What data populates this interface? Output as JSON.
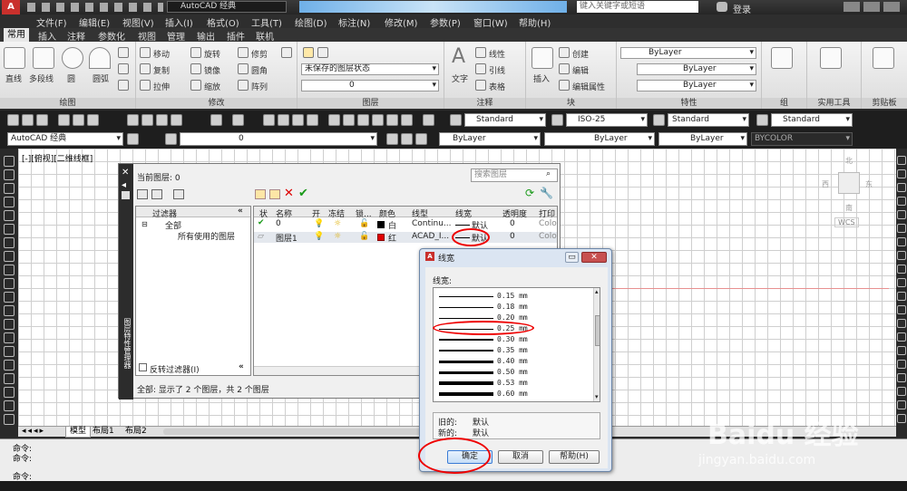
{
  "titlebar": {
    "app_combo": "AutoCAD 经典",
    "search_placeholder": "键入关键字或短语",
    "login": "登录"
  },
  "menu": [
    "文件(F)",
    "编辑(E)",
    "视图(V)",
    "插入(I)",
    "格式(O)",
    "工具(T)",
    "绘图(D)",
    "标注(N)",
    "修改(M)",
    "参数(P)",
    "窗口(W)",
    "帮助(H)"
  ],
  "ribbon_tabs": [
    "常用",
    "插入",
    "注释",
    "参数化",
    "视图",
    "管理",
    "输出",
    "插件",
    "联机"
  ],
  "ribbon": {
    "draw": {
      "label": "绘图",
      "items": [
        "直线",
        "多段线",
        "圆",
        "圆弧"
      ]
    },
    "modify": {
      "label": "修改",
      "items": [
        "移动",
        "旋转",
        "修剪",
        "复制",
        "镜像",
        "圆角",
        "拉伸",
        "缩放",
        "阵列"
      ]
    },
    "layers": {
      "label": "图层",
      "state_combo": "未保存的图层状态",
      "layer_combo": "0"
    },
    "annotation": {
      "label": "注释",
      "text": "文字",
      "items": [
        "线性",
        "引线",
        "表格"
      ]
    },
    "block": {
      "label": "块",
      "insert": "插入",
      "items": [
        "创建",
        "编辑",
        "编辑属性"
      ]
    },
    "properties": {
      "label": "特性",
      "combos": [
        "ByLayer",
        "ByLayer",
        "ByLayer"
      ]
    },
    "group": {
      "label": "组"
    },
    "utilities": {
      "label": "实用工具"
    },
    "clipboard": {
      "label": "剪贴板"
    }
  },
  "toolbar1": {
    "text_style": "Standard",
    "dim_style": "ISO-25",
    "table_style": "Standard",
    "mleader_style": "Standard"
  },
  "toolbar2": {
    "workspace": "AutoCAD 经典",
    "layer": "0",
    "color": "ByLayer",
    "linetype": "ByLayer",
    "lineweight": "ByLayer",
    "plotstyle": "BYCOLOR"
  },
  "viewport_label": "[-][俯视][二维线框]",
  "viewcube": {
    "north": "北",
    "south": "南",
    "west": "西",
    "east": "东",
    "wcs": "WCS"
  },
  "layer_manager": {
    "current_layer": "当前图层: 0",
    "search_placeholder": "搜索图层",
    "side_title": "图层特性管理器",
    "filters_header": "过滤器",
    "tree": [
      "全部",
      "所有使用的图层"
    ],
    "invert_filter": "反转过滤器(I)",
    "columns": [
      "状",
      "名称",
      "开",
      "冻结",
      "锁...",
      "颜色",
      "线型",
      "线宽",
      "透明度",
      "打印"
    ],
    "rows": [
      {
        "name": "0",
        "color": "白",
        "color_hex": "#000000",
        "linetype": "Continu...",
        "lineweight": "默认",
        "transparency": "0",
        "plot": "Colo"
      },
      {
        "name": "图层1",
        "color": "红",
        "color_hex": "#e00000",
        "linetype": "ACAD_I...",
        "lineweight": "默认",
        "transparency": "0",
        "plot": "Colo"
      }
    ],
    "status": "全部: 显示了 2 个图层，共 2 个图层"
  },
  "lineweight_dialog": {
    "title": "线宽",
    "list_label": "线宽:",
    "items": [
      {
        "value": "0.15 mm",
        "thickness": 1
      },
      {
        "value": "0.18 mm",
        "thickness": 1
      },
      {
        "value": "0.20 mm",
        "thickness": 1
      },
      {
        "value": "0.25 mm",
        "thickness": 1
      },
      {
        "value": "0.30 mm",
        "thickness": 2
      },
      {
        "value": "0.35 mm",
        "thickness": 2
      },
      {
        "value": "0.40 mm",
        "thickness": 3
      },
      {
        "value": "0.50 mm",
        "thickness": 3
      },
      {
        "value": "0.53 mm",
        "thickness": 4
      },
      {
        "value": "0.60 mm",
        "thickness": 4
      }
    ],
    "old_label": "旧的:",
    "old_value": "默认",
    "new_label": "新的:",
    "new_value": "默认",
    "ok": "确定",
    "cancel": "取消",
    "help": "帮助(H)"
  },
  "layout_tabs": [
    "模型",
    "布局1",
    "布局2"
  ],
  "command": {
    "line1": "命令:",
    "line2": "命令:",
    "prompt": "命令:"
  },
  "watermark": {
    "logo": "Baidu 经验",
    "url": "jingyan.baidu.com"
  },
  "colors": {
    "highlight_red": "#e00000",
    "dialog_frame": "#dbe5f2"
  }
}
